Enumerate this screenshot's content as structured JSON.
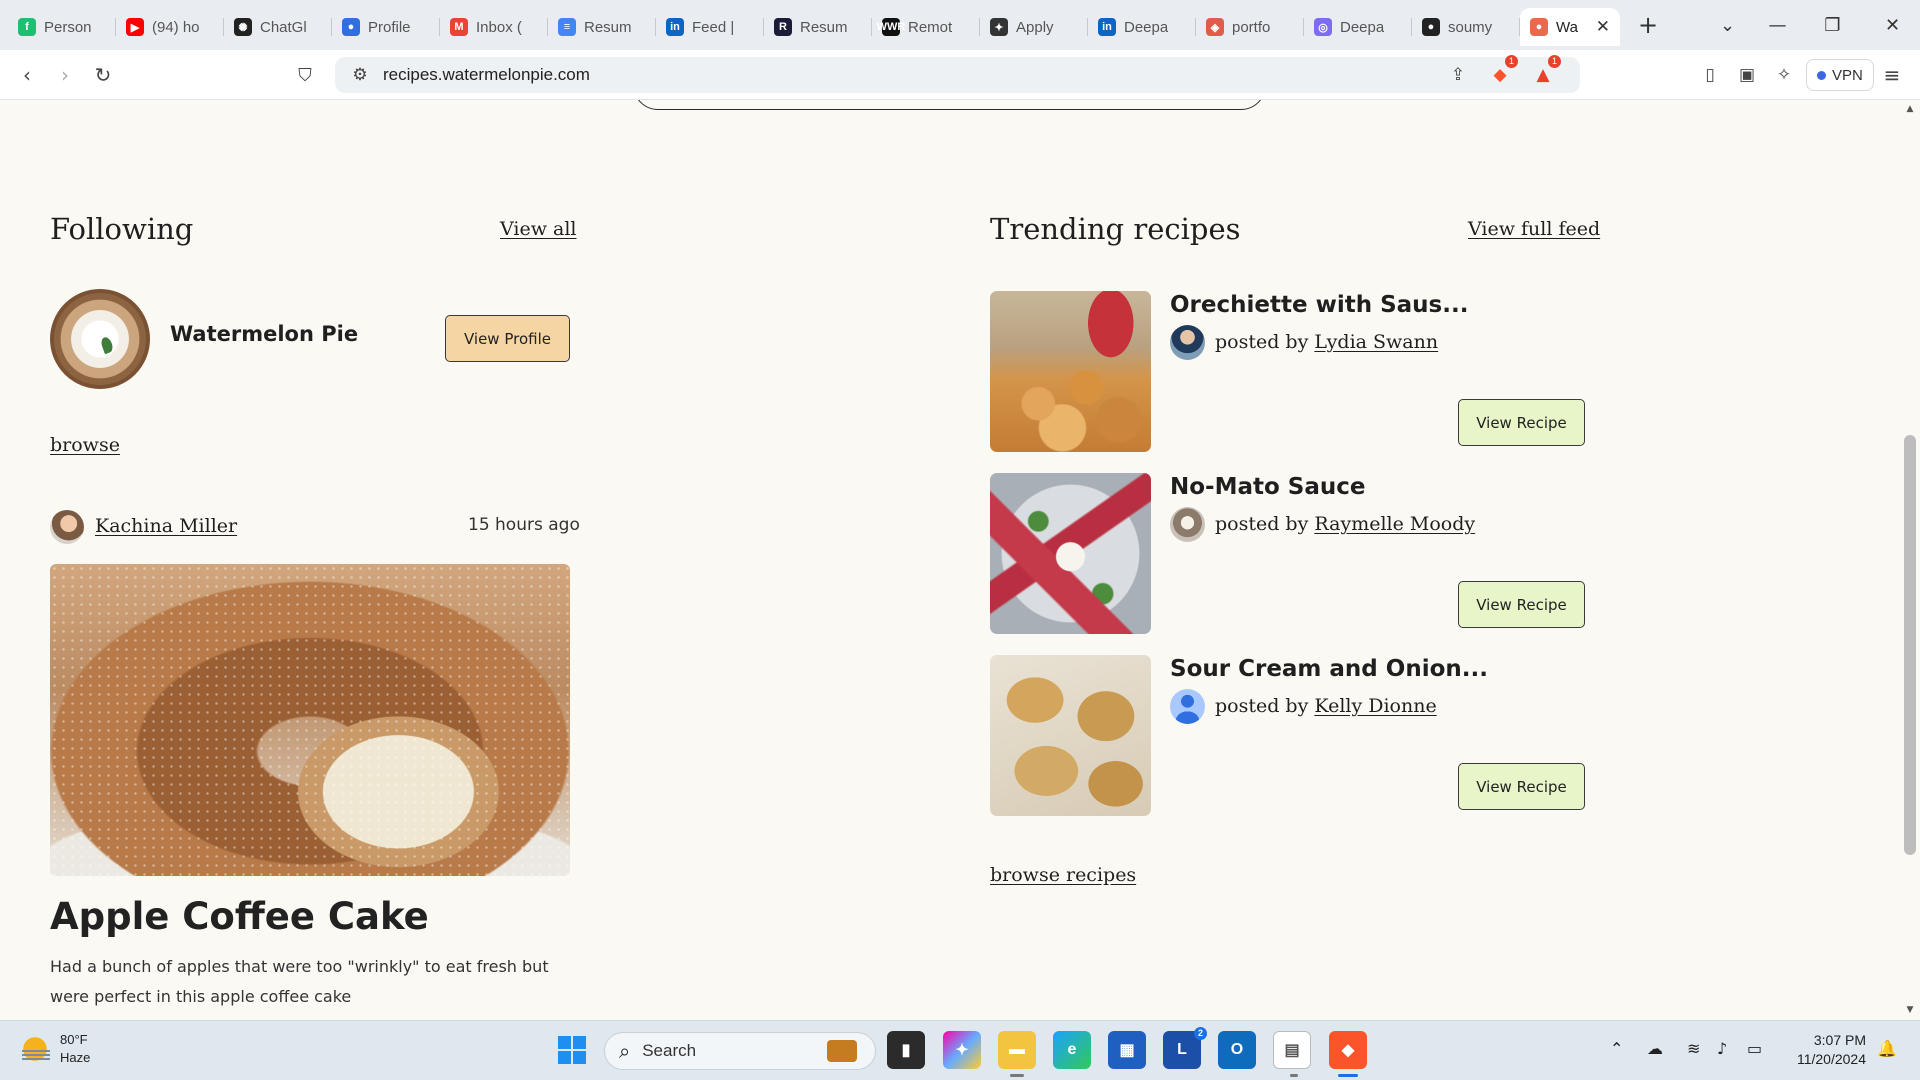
{
  "browser": {
    "tabs": [
      {
        "title": "Person",
        "favicon": "fiverr-icon",
        "color": "#1dbf73",
        "glyph": "f"
      },
      {
        "title": "(94) ho",
        "favicon": "youtube-icon",
        "color": "#ff0000",
        "glyph": "▶"
      },
      {
        "title": "ChatGl",
        "favicon": "chatgpt-icon",
        "color": "#222222",
        "glyph": "✺"
      },
      {
        "title": "Profile",
        "favicon": "profile-icon",
        "color": "#2f6fe0",
        "glyph": "●"
      },
      {
        "title": "Inbox (",
        "favicon": "gmail-icon",
        "color": "#ea4335",
        "glyph": "M"
      },
      {
        "title": "Resum",
        "favicon": "docs-icon",
        "color": "#4285f4",
        "glyph": "≡"
      },
      {
        "title": "Feed |",
        "favicon": "linkedin-icon",
        "color": "#0a66c2",
        "glyph": "in"
      },
      {
        "title": "Resum",
        "favicon": "resume-r-icon",
        "color": "#1b1b3a",
        "glyph": "R"
      },
      {
        "title": "Remot",
        "favicon": "remote-icon",
        "color": "#111111",
        "glyph": "WWR"
      },
      {
        "title": "Apply",
        "favicon": "sparkle-icon",
        "color": "#333333",
        "glyph": "✦"
      },
      {
        "title": "Deepa",
        "favicon": "linkedin-icon",
        "color": "#0a66c2",
        "glyph": "in"
      },
      {
        "title": "portfo",
        "favicon": "shield-icon",
        "color": "#e05b4b",
        "glyph": "◈"
      },
      {
        "title": "Deepa",
        "favicon": "deepa-icon",
        "color": "#7b6cf0",
        "glyph": "◎"
      },
      {
        "title": "soumy",
        "favicon": "github-icon",
        "color": "#222222",
        "glyph": "●"
      },
      {
        "title": "Wa",
        "favicon": "watermelon-icon",
        "color": "#e86a4a",
        "glyph": "●",
        "active": true
      }
    ],
    "url": "recipes.watermelonpie.com",
    "vpn_label": "VPN",
    "brave_badge": "1",
    "rewards_badge": "1"
  },
  "following": {
    "heading": "Following",
    "view_all": "View all",
    "profile_name": "Watermelon Pie",
    "view_profile": "View Profile",
    "browse": "browse"
  },
  "post": {
    "author": "Kachina Miller",
    "time": "15 hours ago",
    "title": "Apple Coffee Cake",
    "description": "Had a bunch of apples that were too \"wrinkly\" to eat fresh but were perfect in this apple coffee cake"
  },
  "trending": {
    "heading": "Trending recipes",
    "view_full_feed": "View full feed",
    "posted_by": "posted by",
    "button_label": "View Recipe",
    "recipes": [
      {
        "title": "Orechiette with Saus...",
        "author": "Lydia Swann"
      },
      {
        "title": "No-Mato Sauce",
        "author": "Raymelle Moody"
      },
      {
        "title": "Sour Cream and Onion...",
        "author": "Kelly Dionne"
      }
    ],
    "browse_recipes": "browse recipes"
  },
  "taskbar": {
    "weather_temp": "80°F",
    "weather_desc": "Haze",
    "search_label": "Search",
    "mail_badge": "2",
    "time": "3:07 PM",
    "date": "11/20/2024"
  },
  "colors": {
    "page_bg": "#fbf9f4",
    "profile_button": "#f6d5a4",
    "recipe_button": "#e8f5c9"
  }
}
